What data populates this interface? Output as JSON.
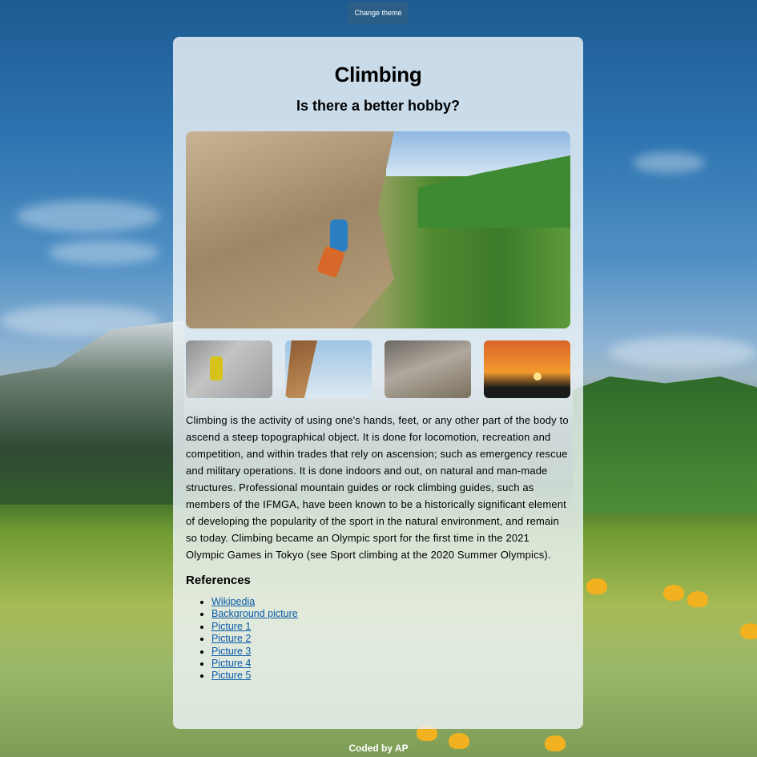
{
  "header": {
    "theme_button_label": "Change theme"
  },
  "card": {
    "title": "Climbing",
    "subtitle": "Is there a better hobby?",
    "body": "Climbing is the activity of using one's hands, feet, or any other part of the body to ascend a steep topographical object. It is done for locomotion, recreation and competition, and within trades that rely on ascension; such as emergency rescue and military operations. It is done indoors and out, on natural and man-made structures. Professional mountain guides or rock climbing guides, such as members of the IFMGA, have been known to be a historically significant element of developing the popularity of the sport in the natural environment, and remain so today. Climbing became an Olympic sport for the first time in the 2021 Olympic Games in Tokyo (see Sport climbing at the 2020 Summer Olympics).",
    "references_heading": "References",
    "references": [
      "Wikipedia",
      "Background picture",
      "Picture 1",
      "Picture 2",
      "Picture 3",
      "Picture 4",
      "Picture 5"
    ]
  },
  "footer": {
    "credit": "Coded by AP"
  },
  "colors": {
    "theme_button": "#2c5f88",
    "link": "#0a5aa8",
    "card_background": "rgba(238,244,248,0.82)"
  }
}
